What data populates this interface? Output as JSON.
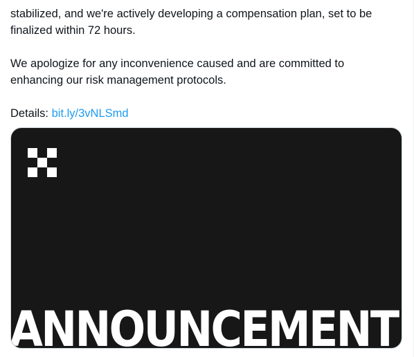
{
  "tweet": {
    "paragraphs": [
      "stabilized, and we're actively developing a compensation plan, set to be finalized within 72 hours.",
      "We apologize for any inconvenience caused and are committed to enhancing our risk management protocols."
    ],
    "details_label": "Details:",
    "details_link": "bit.ly/3vNLSmd"
  },
  "media": {
    "logo_icon": "okx-logo-icon",
    "headline": "ANNOUNCEMENT",
    "background_color": "#171717",
    "text_color": "#ffffff"
  },
  "colors": {
    "link": "#1d9bf0",
    "text": "#0f1419"
  }
}
